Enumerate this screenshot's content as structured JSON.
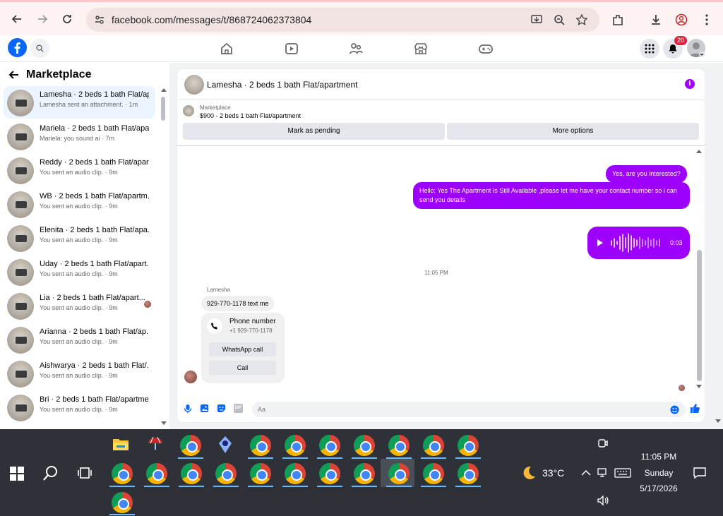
{
  "browser": {
    "url": "facebook.com/messages/t/868724062373804"
  },
  "header": {
    "notification_count": "20"
  },
  "sidebar": {
    "title": "Marketplace",
    "conversations": [
      {
        "name": "Lamesha · 2 beds 1 bath Flat/ap...",
        "sub": "Lamesha sent an attachment. · 1m",
        "active": true
      },
      {
        "name": "Mariela · 2 beds 1 bath Flat/apa...",
        "sub": "Mariela: you sound ai · 7m"
      },
      {
        "name": "Reddy · 2 beds 1 bath Flat/apar...",
        "sub": "You sent an audio clip. · 9m"
      },
      {
        "name": "WB · 2 beds 1 bath Flat/apartm...",
        "sub": "You sent an audio clip. · 9m"
      },
      {
        "name": "Elenita · 2 beds 1 bath Flat/apa...",
        "sub": "You sent an audio clip. · 9m"
      },
      {
        "name": "Uday · 2 beds 1 bath Flat/apart...",
        "sub": "You sent an audio clip. · 9m"
      },
      {
        "name": "Lia · 2 beds 1 bath Flat/apart...",
        "sub": "You sent an audio clip. · 9m"
      },
      {
        "name": "Arianna · 2 beds 1 bath Flat/ap...",
        "sub": "You sent an audio clip. · 9m"
      },
      {
        "name": "Aishwarya · 2 beds 1 bath Flat/...",
        "sub": "You sent an audio clip. · 9m"
      },
      {
        "name": "Bri · 2 beds 1 bath Flat/apartme...",
        "sub": "You sent an audio clip. · 9m"
      }
    ]
  },
  "chat": {
    "title": "Lamesha · 2 beds 1 bath Flat/apartment",
    "marketplace_label": "Marketplace",
    "listing": "$900 - 2 beds 1 bath Flat/apartment",
    "mark_pending": "Mark as pending",
    "more_options": "More options",
    "messages": {
      "out1": "Yes, are you interested?",
      "out2": "Hello: Yes The Apartment Is Still Available ,please let me have your contact number so i can send you details",
      "audio_duration": "0:03",
      "timestamp": "11:05 PM",
      "sender": "Lamesha",
      "in1": "929-770-1178 text me",
      "phone_label": "Phone number",
      "phone_number": "+1 929-770-1178",
      "whatsapp": "WhatsApp call",
      "call": "Call"
    },
    "input_placeholder": "Aa"
  },
  "taskbar": {
    "temperature": "33°C",
    "time": "11:05 PM",
    "day": "Sunday",
    "date": "5/17/2026"
  },
  "colors": {
    "accent": "#9d00ff",
    "fb_blue": "#0866ff"
  }
}
